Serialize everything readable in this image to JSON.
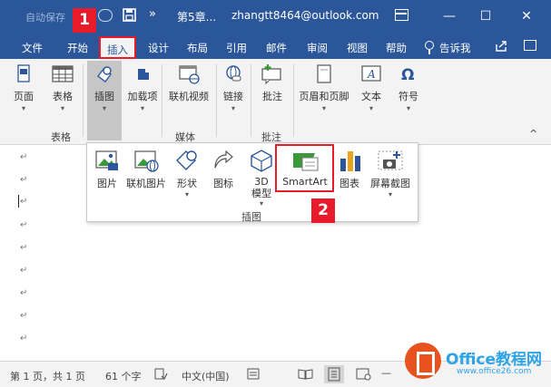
{
  "titlebar": {
    "autosave_label": "自动保存",
    "more_symbol": "»",
    "doc_title": "第5章...",
    "account": "zhangtt8464@outlook.com",
    "minimize": "—",
    "maximize": "☐",
    "close": "✕"
  },
  "tabs": [
    "文件",
    "开始",
    "插入",
    "设计",
    "布局",
    "引用",
    "邮件",
    "审阅",
    "视图",
    "帮助"
  ],
  "active_tab": "插入",
  "tell_me": "告诉我",
  "ribbon": {
    "buttons": [
      {
        "label": "页面",
        "icon": "page-icon",
        "dropdown": true
      },
      {
        "label": "表格",
        "icon": "table-icon",
        "dropdown": true
      },
      {
        "label": "插图",
        "icon": "illustrations-icon",
        "dropdown": true
      },
      {
        "label": "加载项",
        "icon": "addins-icon",
        "dropdown": true
      },
      {
        "label": "联机视频",
        "icon": "online-video-icon",
        "dropdown": false
      },
      {
        "label": "链接",
        "icon": "link-icon",
        "dropdown": true
      },
      {
        "label": "批注",
        "icon": "comment-icon",
        "dropdown": false
      },
      {
        "label": "页眉和页脚",
        "icon": "header-footer-icon",
        "dropdown": true
      },
      {
        "label": "文本",
        "icon": "text-icon",
        "dropdown": true
      },
      {
        "label": "符号",
        "icon": "symbol-icon",
        "dropdown": true
      }
    ],
    "group_labels": {
      "tables": "表格",
      "media": "媒体",
      "comments": "批注"
    },
    "collapse_symbol": "^"
  },
  "dropdown": {
    "items": [
      {
        "label": "图片",
        "icon": "picture-icon",
        "dropdown": false
      },
      {
        "label": "联机图片",
        "icon": "online-picture-icon",
        "dropdown": false
      },
      {
        "label": "形状",
        "icon": "shapes-icon",
        "dropdown": true
      },
      {
        "label": "图标",
        "icon": "icons-icon",
        "dropdown": false
      },
      {
        "label": "3D 模型",
        "icon": "3d-model-icon",
        "dropdown": true
      },
      {
        "label": "SmartArt",
        "icon": "smartart-icon",
        "dropdown": false
      },
      {
        "label": "图表",
        "icon": "chart-icon",
        "dropdown": false
      },
      {
        "label": "屏幕截图",
        "icon": "screenshot-icon",
        "dropdown": true
      }
    ],
    "group_label": "插图",
    "arrow_symbol": "▾"
  },
  "callouts": [
    "1",
    "2"
  ],
  "para_mark": "↵",
  "statusbar": {
    "page_info": "第 1 页，共 1 页",
    "word_count": "61 个字",
    "language": "中文(中国)",
    "zoom_minus": "—"
  },
  "watermark": {
    "brand": "Office教程网",
    "url": "www.office26.com"
  },
  "colors": {
    "accent": "#2b579a",
    "highlight": "#e81b2b",
    "ribbon_bg": "#f3f3f3"
  }
}
